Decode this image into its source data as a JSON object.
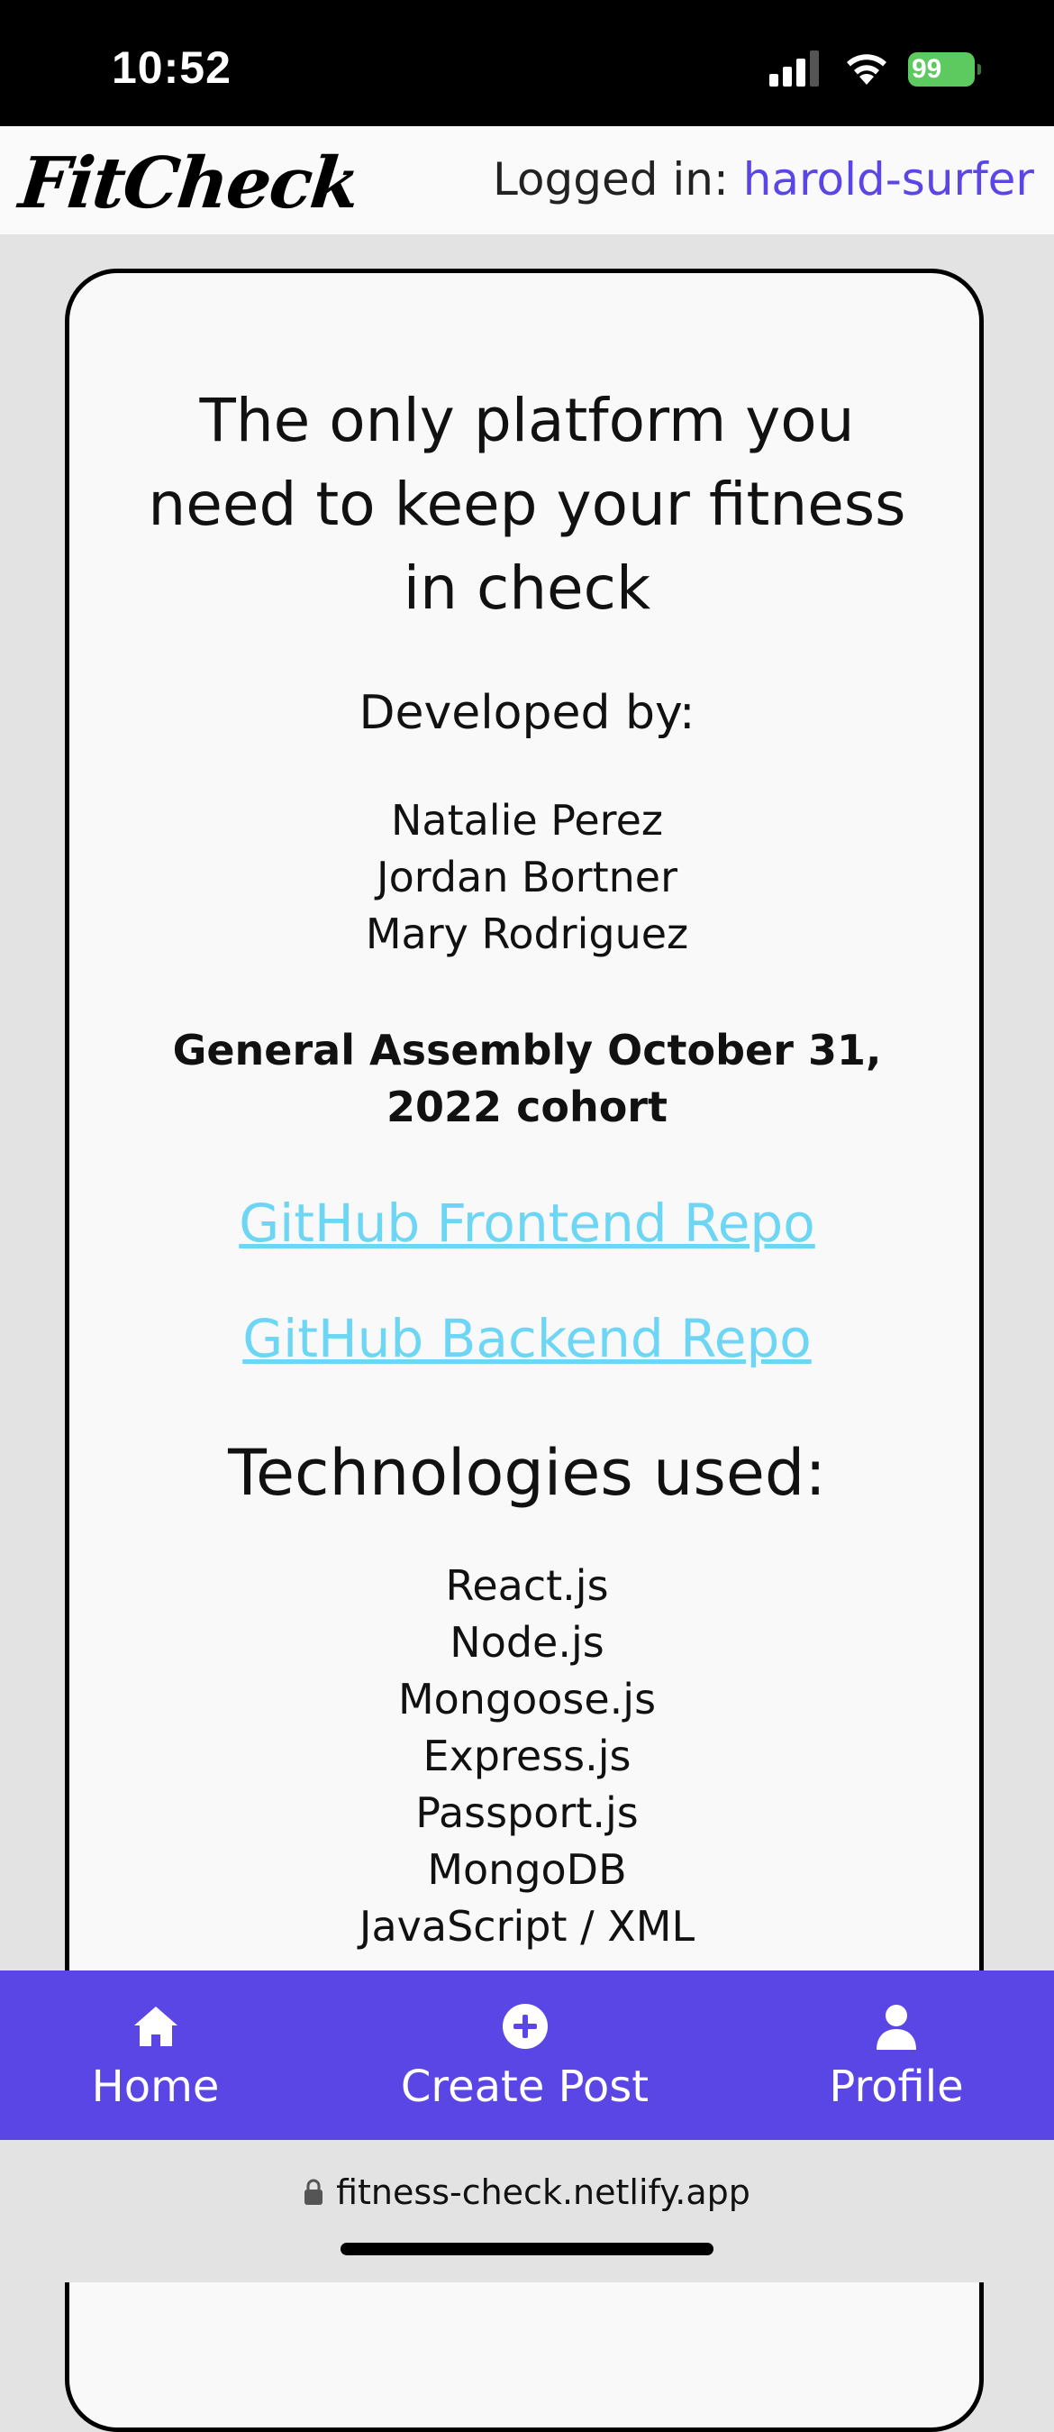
{
  "status_bar": {
    "time": "10:52",
    "battery_level": "99",
    "icons": [
      "signal-icon",
      "wifi-icon",
      "battery-icon"
    ]
  },
  "header": {
    "logo": "FitCheck",
    "logged_in_label": "Logged in: ",
    "username": "harold-surfer"
  },
  "about": {
    "tagline": "The only platform you need to keep your fitness in check",
    "developed_by_heading": "Developed by:",
    "developers": [
      "Natalie Perez",
      "Jordan Bortner",
      "Mary Rodriguez"
    ],
    "cohort": "General Assembly October 31, 2022 cohort",
    "frontend_link": "GitHub Frontend Repo",
    "backend_link": "GitHub Backend Repo",
    "technologies_heading": "Technologies used:",
    "technologies": [
      "React.js",
      "Node.js",
      "Mongoose.js",
      "Express.js",
      "Passport.js",
      "MongoDB",
      "JavaScript / XML"
    ]
  },
  "nav": {
    "items": [
      {
        "label": "Home",
        "icon": "home-icon"
      },
      {
        "label": "Create Post",
        "icon": "plus-circle-icon"
      },
      {
        "label": "Profile",
        "icon": "user-icon"
      }
    ]
  },
  "browser": {
    "url": "fitness-check.netlify.app"
  },
  "colors": {
    "accent": "#5a46e5",
    "link": "#6dd6f4",
    "battery": "#5dca5f"
  }
}
